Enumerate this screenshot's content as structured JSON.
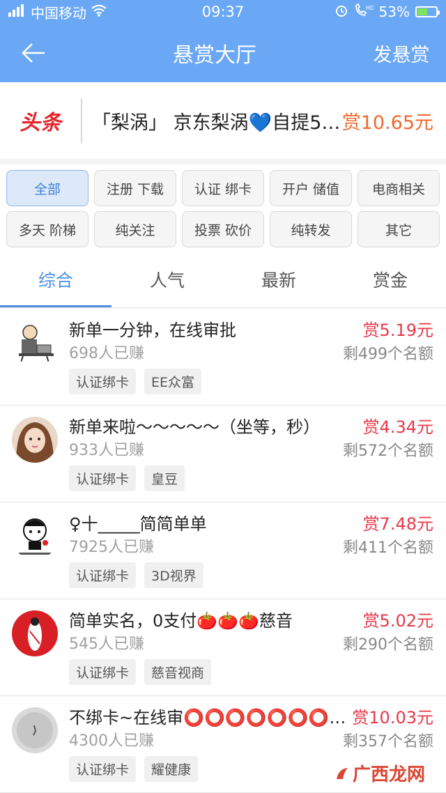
{
  "status_bar": {
    "carrier": "中国移动",
    "time": "09:37",
    "network": "HD",
    "battery_percent": "53%",
    "battery_level": 0.53
  },
  "nav": {
    "title": "悬赏大厅",
    "action": "发悬赏",
    "back_icon": "arrow-left-icon"
  },
  "ticker": {
    "logo": "头条",
    "text": "「梨涡」 京东梨涡💙自提5…",
    "reward": "赏10.65元"
  },
  "filters": [
    {
      "label": "全部",
      "active": true
    },
    {
      "label": "注册 下载",
      "active": false
    },
    {
      "label": "认证 绑卡",
      "active": false
    },
    {
      "label": "开户 储值",
      "active": false
    },
    {
      "label": "电商相关",
      "active": false
    },
    {
      "label": "多天 阶梯",
      "active": false
    },
    {
      "label": "纯关注",
      "active": false
    },
    {
      "label": "投票 砍价",
      "active": false
    },
    {
      "label": "纯转发",
      "active": false
    },
    {
      "label": "其它",
      "active": false
    }
  ],
  "tabs": [
    {
      "label": "综合",
      "active": true
    },
    {
      "label": "人气",
      "active": false
    },
    {
      "label": "最新",
      "active": false
    },
    {
      "label": "赏金",
      "active": false
    }
  ],
  "tasks": [
    {
      "title": "新单一分钟，在线审批",
      "count": "698人已赚",
      "reward": "赏5.19元",
      "remain": "剩499个名额",
      "tags": [
        "认证绑卡",
        "EE众富"
      ],
      "avatar": "cartoon-laptop"
    },
    {
      "title": "新单来啦～～～～～（坐等，秒）",
      "count": "933人已赚",
      "reward": "赏4.34元",
      "remain": "剩572个名额",
      "tags": [
        "认证绑卡",
        "皇豆"
      ],
      "avatar": "girl-photo"
    },
    {
      "title": "♀十_____简简单单",
      "count": "7925人已赚",
      "reward": "赏7.48元",
      "remain": "剩411个名额",
      "tags": [
        "认证绑卡",
        "3D视界"
      ],
      "avatar": "meme-rose"
    },
    {
      "title": "简单实名，0支付🍅🍅🍅慈音",
      "count": "545人已赚",
      "reward": "赏5.02元",
      "remain": "剩290个名额",
      "tags": [
        "认证绑卡",
        "慈音视商"
      ],
      "avatar": "red-circle"
    },
    {
      "title": "不绑卡~在线审⭕⭕⭕⭕⭕⭕⭕…",
      "count": "4300人已赚",
      "reward": "赏10.03元",
      "remain": "剩357个名额",
      "tags": [
        "认证绑卡",
        "耀健康"
      ],
      "avatar": "gray-dot"
    }
  ],
  "watermark": "广西龙网"
}
